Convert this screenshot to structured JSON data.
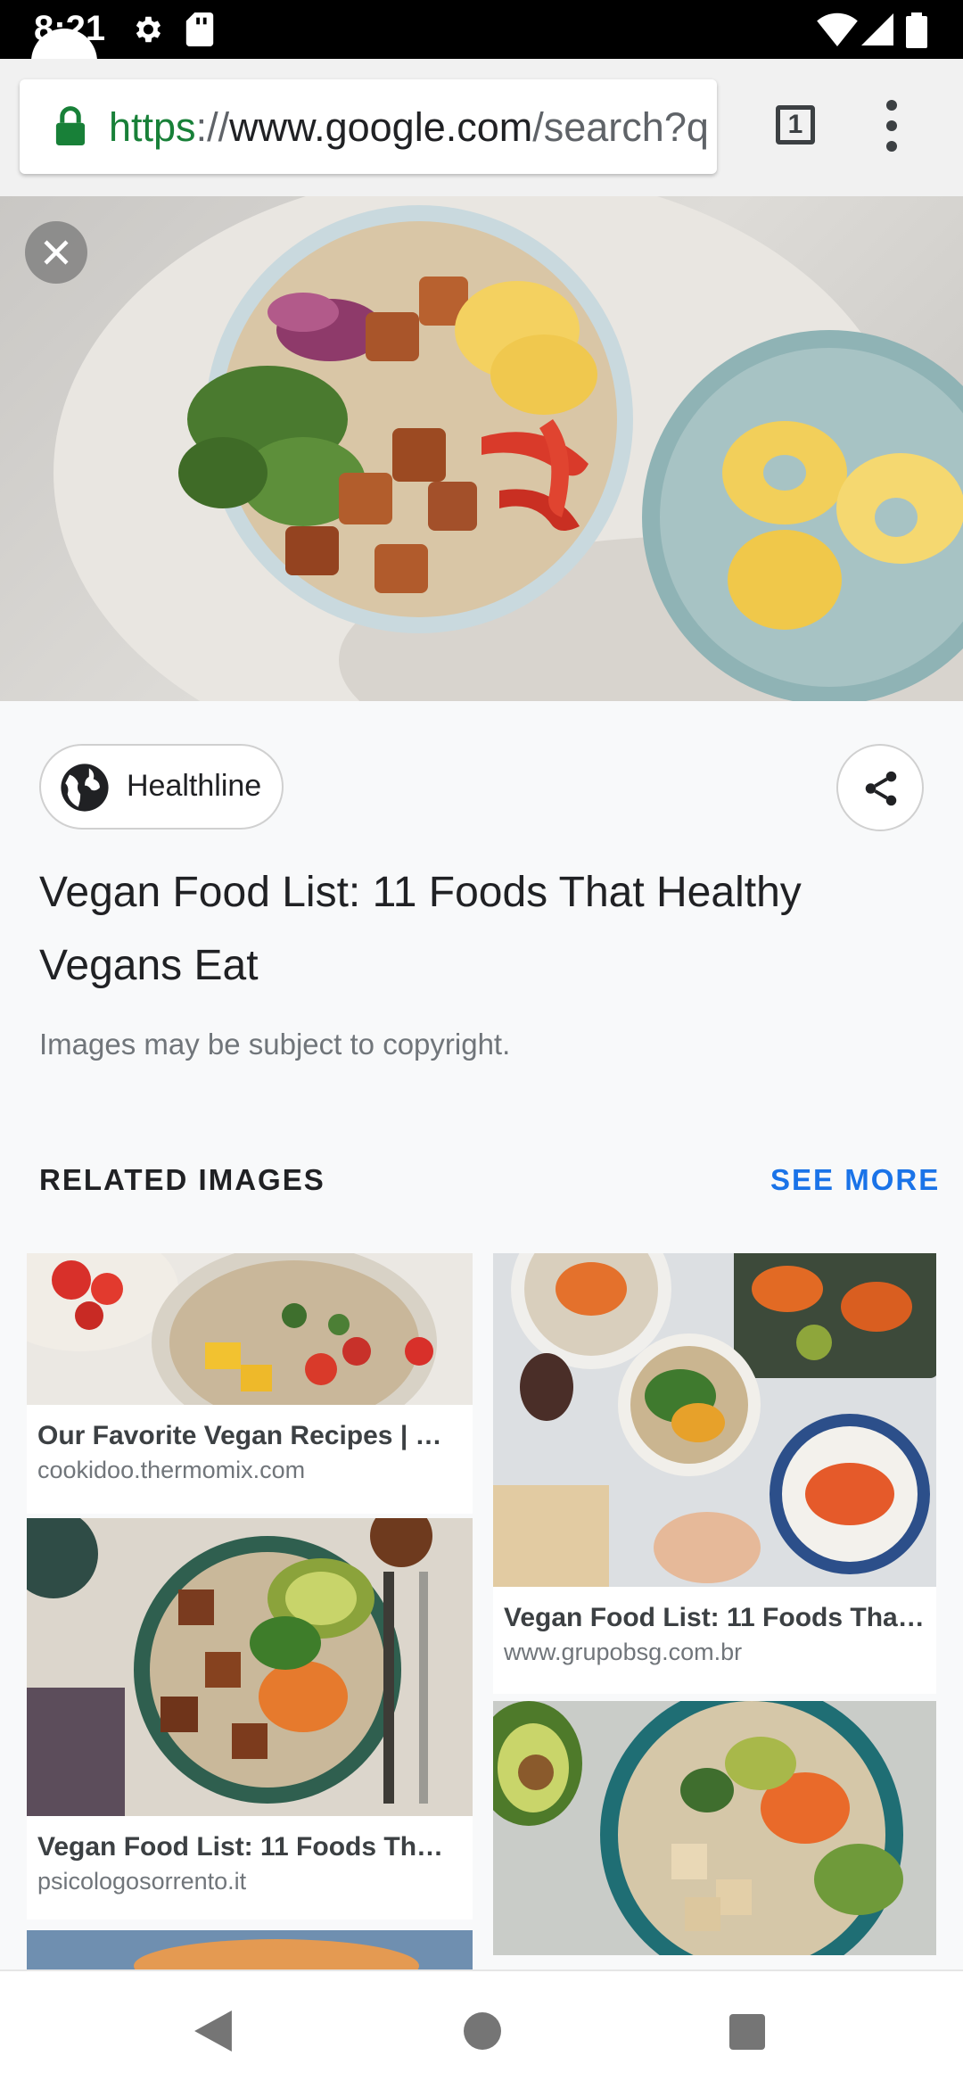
{
  "status_bar": {
    "time": "8:21"
  },
  "browser": {
    "url_scheme": "https",
    "url_sep": "://",
    "url_host": "www.google.com",
    "url_path": "/search?q",
    "tab_count": "1"
  },
  "result": {
    "source": "Healthline",
    "title": "Vegan Food List: 11 Foods That Healthy Vegans Eat",
    "copyright": "Images may be subject to copyright."
  },
  "related": {
    "heading": "RELATED IMAGES",
    "see_more": "SEE MORE",
    "items": [
      {
        "title": "Our Favorite Vegan Recipes | Co...",
        "site": "cookidoo.thermomix.com"
      },
      {
        "title": "Vegan Food List: 11 Foods That ...",
        "site": "www.grupobsg.com.br"
      },
      {
        "title": "Vegan Food List: 11 Foods That ...",
        "site": "psicologosorrento.it"
      }
    ]
  },
  "colors": {
    "accent": "#1a73e8",
    "secure": "#188038",
    "text": "#202124",
    "muted": "#70757a"
  }
}
